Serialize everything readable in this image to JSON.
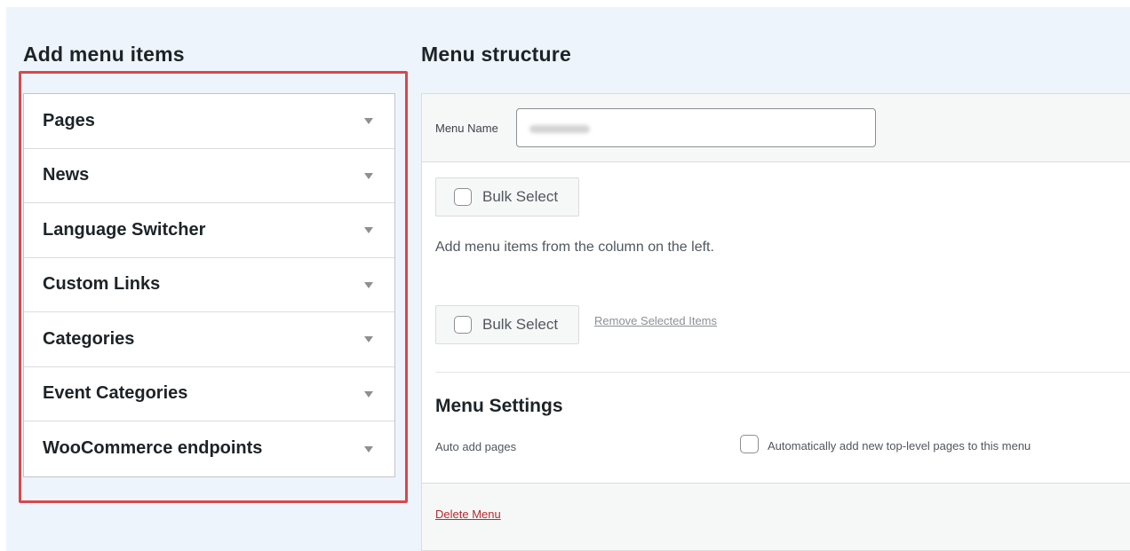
{
  "left": {
    "title": "Add menu items",
    "items": [
      {
        "label": "Pages"
      },
      {
        "label": "News"
      },
      {
        "label": "Language Switcher"
      },
      {
        "label": "Custom Links"
      },
      {
        "label": "Categories"
      },
      {
        "label": "Event Categories"
      },
      {
        "label": "WooCommerce endpoints"
      }
    ]
  },
  "right": {
    "title": "Menu structure",
    "menu_name_label": "Menu Name",
    "menu_name_value": "",
    "bulk_select_label": "Bulk Select",
    "hint": "Add menu items from the column on the left.",
    "remove_selected": "Remove Selected Items",
    "settings_title": "Menu Settings",
    "auto_add_label": "Auto add pages",
    "auto_add_desc": "Automatically add new top-level pages to this menu",
    "delete_menu": "Delete Menu"
  },
  "colors": {
    "highlight": "#d9474b",
    "background": "#eef4fb",
    "delete_link": "#b32d2e"
  },
  "icons": [
    "chevron-down-icon",
    "checkbox-icon"
  ]
}
